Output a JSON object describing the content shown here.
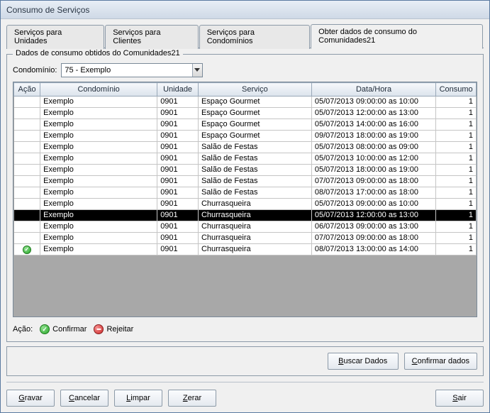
{
  "window": {
    "title": "Consumo de Serviços"
  },
  "tabs": [
    {
      "label": "Serviços para Unidades",
      "active": false
    },
    {
      "label": "Serviços para Clientes",
      "active": false
    },
    {
      "label": "Serviços para Condomínios",
      "active": false
    },
    {
      "label": "Obter dados de consumo do Comunidades21",
      "active": true
    }
  ],
  "fieldset": {
    "legend": "Dados de consumo obtidos do Comunidades21",
    "condominio_label": "Condomínio:",
    "condominio_value": "75 - Exemplo"
  },
  "columns": {
    "acao": "Ação",
    "condominio": "Condomínio",
    "unidade": "Unidade",
    "servico": "Serviço",
    "datahora": "Data/Hora",
    "consumo": "Consumo"
  },
  "rows": [
    {
      "acao": "",
      "condominio": "Exemplo",
      "unidade": "0901",
      "servico": "Espaço Gourmet",
      "datahora": "05/07/2013 09:00:00 as 10:00",
      "consumo": "1",
      "selected": false
    },
    {
      "acao": "",
      "condominio": "Exemplo",
      "unidade": "0901",
      "servico": "Espaço Gourmet",
      "datahora": "05/07/2013 12:00:00 as 13:00",
      "consumo": "1",
      "selected": false
    },
    {
      "acao": "",
      "condominio": "Exemplo",
      "unidade": "0901",
      "servico": "Espaço Gourmet",
      "datahora": "05/07/2013 14:00:00 as 16:00",
      "consumo": "1",
      "selected": false
    },
    {
      "acao": "",
      "condominio": "Exemplo",
      "unidade": "0901",
      "servico": "Espaço Gourmet",
      "datahora": "09/07/2013 18:00:00 as 19:00",
      "consumo": "1",
      "selected": false
    },
    {
      "acao": "",
      "condominio": "Exemplo",
      "unidade": "0901",
      "servico": "Salão de Festas",
      "datahora": "05/07/2013 08:00:00 as 09:00",
      "consumo": "1",
      "selected": false
    },
    {
      "acao": "",
      "condominio": "Exemplo",
      "unidade": "0901",
      "servico": "Salão de Festas",
      "datahora": "05/07/2013 10:00:00 as 12:00",
      "consumo": "1",
      "selected": false
    },
    {
      "acao": "",
      "condominio": "Exemplo",
      "unidade": "0901",
      "servico": "Salão de Festas",
      "datahora": "05/07/2013 18:00:00 as 19:00",
      "consumo": "1",
      "selected": false
    },
    {
      "acao": "",
      "condominio": "Exemplo",
      "unidade": "0901",
      "servico": "Salão de Festas",
      "datahora": "07/07/2013 09:00:00 as 18:00",
      "consumo": "1",
      "selected": false
    },
    {
      "acao": "",
      "condominio": "Exemplo",
      "unidade": "0901",
      "servico": "Salão de Festas",
      "datahora": "08/07/2013 17:00:00 as 18:00",
      "consumo": "1",
      "selected": false
    },
    {
      "acao": "",
      "condominio": "Exemplo",
      "unidade": "0901",
      "servico": "Churrasqueira",
      "datahora": "05/07/2013 09:00:00 as 10:00",
      "consumo": "1",
      "selected": false
    },
    {
      "acao": "",
      "condominio": "Exemplo",
      "unidade": "0901",
      "servico": "Churrasqueira",
      "datahora": "05/07/2013 12:00:00 as 13:00",
      "consumo": "1",
      "selected": true
    },
    {
      "acao": "",
      "condominio": "Exemplo",
      "unidade": "0901",
      "servico": "Churrasqueira",
      "datahora": "06/07/2013 09:00:00 as 13:00",
      "consumo": "1",
      "selected": false
    },
    {
      "acao": "",
      "condominio": "Exemplo",
      "unidade": "0901",
      "servico": "Churrasqueira",
      "datahora": "07/07/2013 09:00:00 as 18:00",
      "consumo": "1",
      "selected": false
    },
    {
      "acao": "check",
      "condominio": "Exemplo",
      "unidade": "0901",
      "servico": "Churrasqueira",
      "datahora": "08/07/2013 13:00:00 as 14:00",
      "consumo": "1",
      "selected": false
    }
  ],
  "legend_row": {
    "label": "Ação:",
    "confirm": "Confirmar",
    "reject": "Rejeitar"
  },
  "panel": {
    "buscar": "Buscar Dados",
    "confirmar": "Confirmar dados"
  },
  "footer": {
    "gravar": "Gravar",
    "cancelar": "Cancelar",
    "limpar": "Limpar",
    "zerar": "Zerar",
    "sair": "Sair"
  }
}
